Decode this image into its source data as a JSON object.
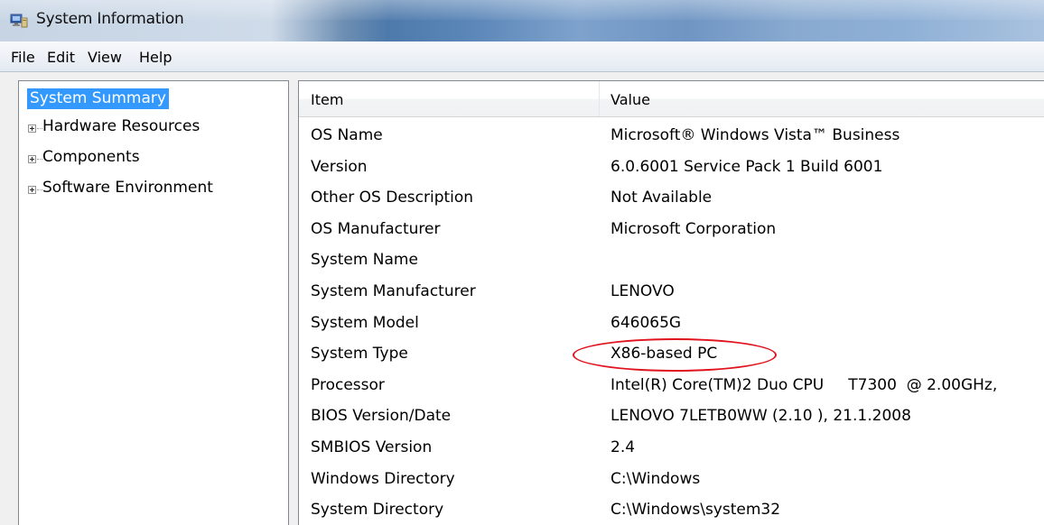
{
  "window": {
    "title": "System Information",
    "icon": "system-information-icon"
  },
  "menu": [
    "File",
    "Edit",
    "View",
    "Help"
  ],
  "tree": {
    "selected": "System Summary",
    "items": [
      {
        "label": "System Summary",
        "expandable": false,
        "selected": true
      },
      {
        "label": "Hardware Resources",
        "expandable": true
      },
      {
        "label": "Components",
        "expandable": true
      },
      {
        "label": "Software Environment",
        "expandable": true
      }
    ]
  },
  "list": {
    "columns": [
      "Item",
      "Value"
    ],
    "rows": [
      {
        "item": "OS Name",
        "value": "Microsoft® Windows Vista™ Business"
      },
      {
        "item": "Version",
        "value": "6.0.6001 Service Pack 1 Build 6001"
      },
      {
        "item": "Other OS Description",
        "value": "Not Available"
      },
      {
        "item": "OS Manufacturer",
        "value": "Microsoft Corporation"
      },
      {
        "item": "System Name",
        "value": ""
      },
      {
        "item": "System Manufacturer",
        "value": "LENOVO"
      },
      {
        "item": "System Model",
        "value": "646065G"
      },
      {
        "item": "System Type",
        "value": "X86-based PC"
      },
      {
        "item": "Processor",
        "value": "Intel(R) Core(TM)2 Duo CPU     T7300  @ 2.00GHz,"
      },
      {
        "item": "BIOS Version/Date",
        "value": "LENOVO 7LETB0WW (2.10 ), 21.1.2008"
      },
      {
        "item": "SMBIOS Version",
        "value": "2.4"
      },
      {
        "item": "Windows Directory",
        "value": "C:\\Windows"
      },
      {
        "item": "System Directory",
        "value": "C:\\Windows\\system32"
      }
    ],
    "annotated_item": "System Type",
    "annotation_color": "#e0141e"
  },
  "colors": {
    "selection": "#3399ff",
    "pane_border": "#828790"
  }
}
